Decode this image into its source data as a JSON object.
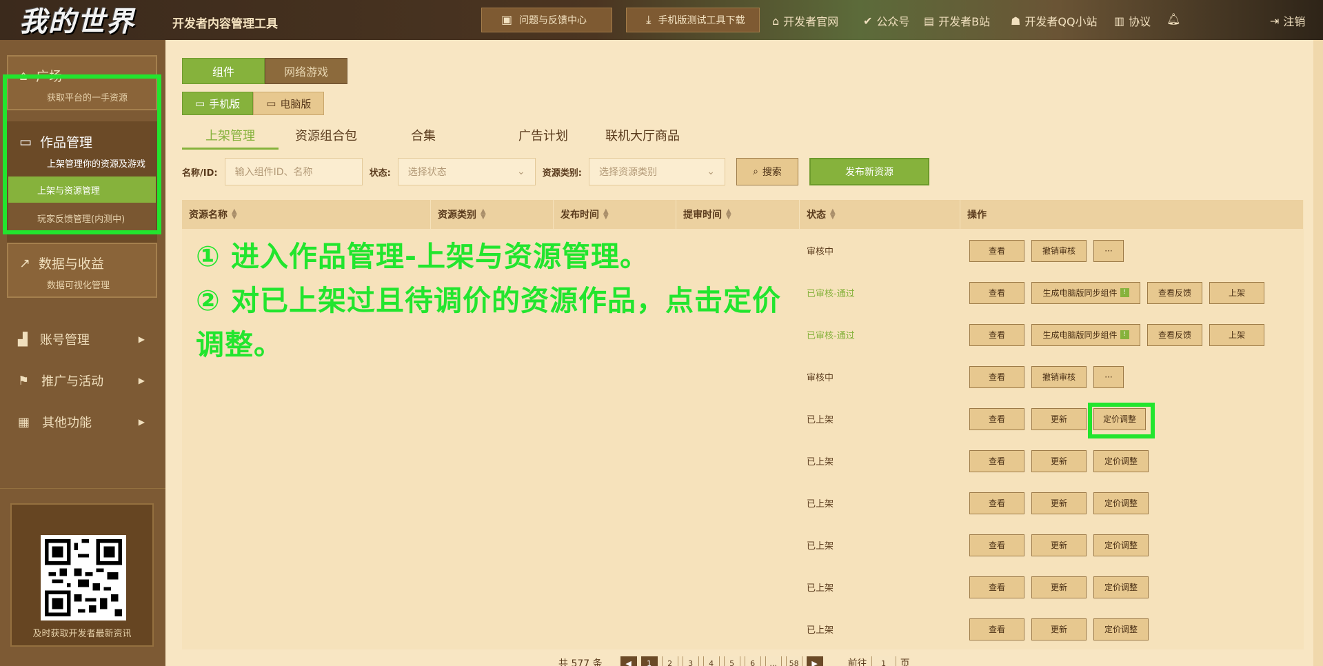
{
  "header": {
    "logo_text": "我的世界",
    "app_title": "开发者内容管理工具",
    "feedback_btn": "问题与反馈中心",
    "mobile_tools_btn": "手机版测试工具下载",
    "links": [
      "开发者官网",
      "公众号",
      "开发者B站",
      "开发者QQ小站",
      "协议"
    ],
    "logout": "注销"
  },
  "sidebar": {
    "plaza": {
      "title": "广场",
      "subtitle": "获取平台的一手资源"
    },
    "works": {
      "title": "作品管理",
      "subtitle": "上架管理你的资源及游戏",
      "sub_items": [
        "上架与资源管理",
        "玩家反馈管理(内测中)"
      ]
    },
    "data": {
      "title": "数据与收益",
      "subtitle": "数据可视化管理"
    },
    "nav": [
      "账号管理",
      "推广与活动",
      "其他功能"
    ],
    "qr_caption": "及时获取开发者最新资讯"
  },
  "main": {
    "type_tabs": [
      "组件",
      "网络游戏"
    ],
    "platform_tabs": [
      "手机版",
      "电脑版"
    ],
    "sub_tabs": [
      "上架管理",
      "资源组合包",
      "合集",
      "广告计划",
      "联机大厅商品"
    ],
    "filters": {
      "name_label": "名称/ID:",
      "name_placeholder": "输入组件ID、名称",
      "status_label": "状态:",
      "status_placeholder": "选择状态",
      "type_label": "资源类别:",
      "type_placeholder": "选择资源类别",
      "search_btn": "搜索",
      "publish_btn": "发布新资源"
    },
    "table": {
      "headers": [
        "资源名称",
        "资源类别",
        "发布时间",
        "提审时间",
        "状态",
        "操作"
      ],
      "rows": [
        {
          "status": "审核中",
          "actions": [
            "查看",
            "撤销审核",
            "···"
          ]
        },
        {
          "status": "已审核-通过",
          "actions": [
            "查看",
            "生成电脑版同步组件",
            "查看反馈",
            "上架"
          ]
        },
        {
          "status": "已审核-通过",
          "actions": [
            "查看",
            "生成电脑版同步组件",
            "查看反馈",
            "上架"
          ]
        },
        {
          "status": "审核中",
          "actions": [
            "查看",
            "撤销审核",
            "···"
          ]
        },
        {
          "status": "已上架",
          "actions": [
            "查看",
            "更新",
            "定价调整"
          ]
        },
        {
          "status": "已上架",
          "actions": [
            "查看",
            "更新",
            "定价调整"
          ]
        },
        {
          "status": "已上架",
          "actions": [
            "查看",
            "更新",
            "定价调整"
          ]
        },
        {
          "status": "已上架",
          "actions": [
            "查看",
            "更新",
            "定价调整"
          ]
        },
        {
          "status": "已上架",
          "actions": [
            "查看",
            "更新",
            "定价调整"
          ]
        },
        {
          "status": "已上架",
          "actions": [
            "查看",
            "更新",
            "定价调整"
          ]
        }
      ]
    },
    "pager": {
      "total": "共 577 条",
      "pages": [
        "1",
        "2",
        "3",
        "4",
        "5",
        "6",
        "...",
        "58"
      ],
      "goto": "前往",
      "page_unit": "页",
      "goto_value": "1"
    }
  },
  "annotation": {
    "line1": "① 进入作品管理-上架与资源管理。",
    "line2": "② 对已上架过且待调价的资源作品，点击定价调整。"
  },
  "colors": {
    "accent": "#86b23c",
    "highlight": "#22e52e",
    "sidebar": "#7d5a34",
    "background": "#f8e6c3"
  }
}
